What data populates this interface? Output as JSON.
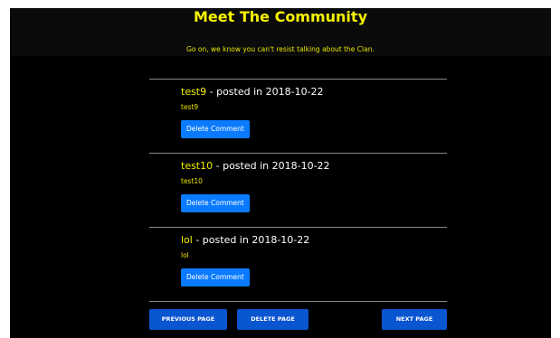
{
  "header": {
    "title": "Meet The Community",
    "subtitle": "Go on, we know you can't resist talking about the Clan."
  },
  "comments": [
    {
      "author": "test9",
      "posted": " - posted in 2018-10-22",
      "body": "test9",
      "delete_label": "Delete Comment"
    },
    {
      "author": "test10",
      "posted": " - posted in 2018-10-22",
      "body": "test10",
      "delete_label": "Delete Comment"
    },
    {
      "author": "lol",
      "posted": " - posted in 2018-10-22",
      "body": "lol",
      "delete_label": "Delete Comment"
    }
  ],
  "pagination": {
    "previous_label": "PREVIOUS PAGE",
    "delete_label": "DELETE PAGE",
    "next_label": "NEXT PAGE"
  },
  "colors": {
    "background": "#000000",
    "accent_yellow": "#f7f300",
    "button_blue": "#0a7bff",
    "pager_blue": "#0a55d0"
  }
}
